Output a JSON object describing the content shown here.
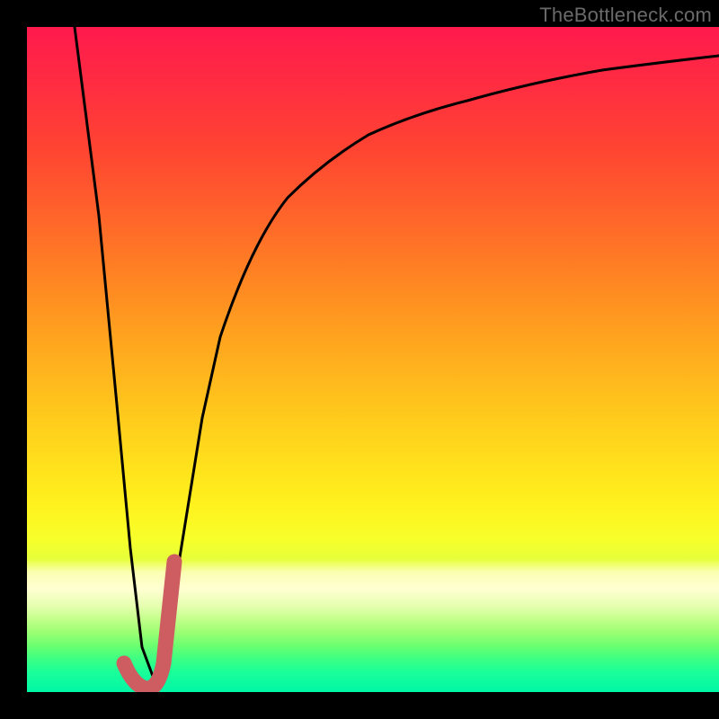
{
  "watermark": "TheBottleneck.com",
  "colors": {
    "curve_main": "#000000",
    "curve_highlight": "#cd5d60",
    "background_frame": "#000000"
  },
  "chart_data": {
    "type": "line",
    "title": "",
    "xlabel": "",
    "ylabel": "",
    "xlim": [
      0,
      100
    ],
    "ylim": [
      0,
      100
    ],
    "grid": false,
    "legend": false,
    "series": [
      {
        "name": "black-curve",
        "x": [
          7,
          10,
          13,
          15,
          17,
          19,
          20,
          22,
          25,
          28,
          32,
          36,
          40,
          45,
          50,
          55,
          60,
          66,
          72,
          78,
          85,
          92,
          100
        ],
        "y": [
          100,
          70,
          40,
          18,
          4,
          0,
          6,
          20,
          40,
          55,
          66,
          74,
          79,
          83,
          86,
          88.5,
          90.5,
          92,
          93,
          94,
          95,
          95.8,
          96.3
        ]
      },
      {
        "name": "highlight-j",
        "x": [
          14,
          15,
          16.5,
          18,
          19,
          20,
          21,
          22
        ],
        "y": [
          3,
          1.5,
          0.5,
          0.5,
          2,
          8,
          15,
          22
        ]
      }
    ]
  }
}
